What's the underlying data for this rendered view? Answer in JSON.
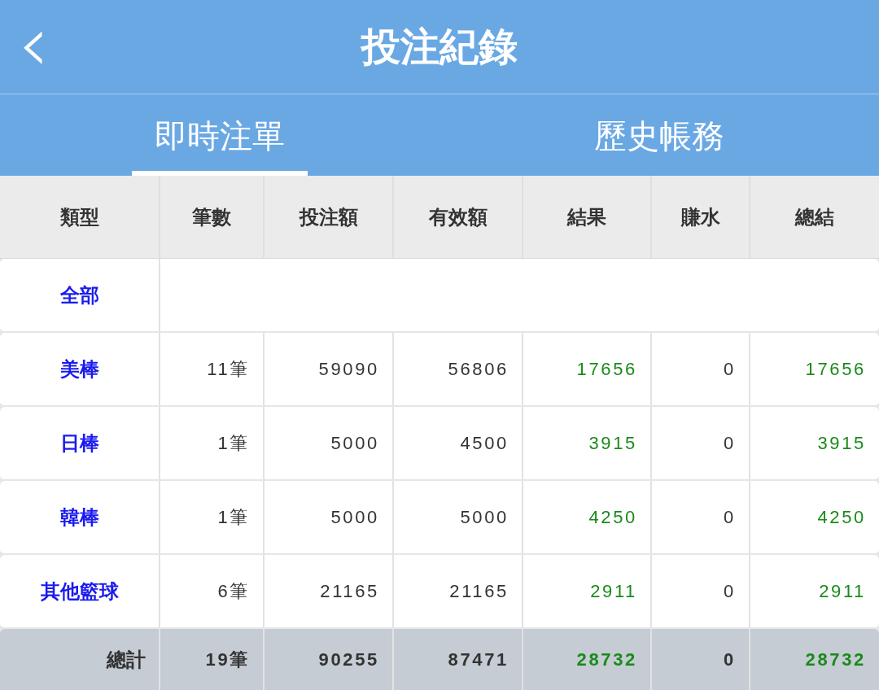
{
  "header": {
    "back_icon": "‹",
    "title": "投注紀錄"
  },
  "tabs": [
    {
      "label": "即時注單",
      "selected": true
    },
    {
      "label": "歷史帳務",
      "selected": false
    }
  ],
  "table": {
    "columns": [
      "類型",
      "筆數",
      "投注額",
      "有效額",
      "結果",
      "賺水",
      "總結"
    ],
    "rows": [
      {
        "type": "全部",
        "cells": []
      },
      {
        "type": "美棒",
        "cells": [
          {
            "text": "11筆",
            "color": "#333333"
          },
          {
            "text": "59090",
            "color": "#333333"
          },
          {
            "text": "56806",
            "color": "#333333"
          },
          {
            "text": "17656",
            "color": "#1a8a1a"
          },
          {
            "text": "0",
            "color": "#333333"
          },
          {
            "text": "17656",
            "color": "#1a8a1a"
          }
        ]
      },
      {
        "type": "日棒",
        "cells": [
          {
            "text": "1筆",
            "color": "#333333"
          },
          {
            "text": "5000",
            "color": "#333333"
          },
          {
            "text": "4500",
            "color": "#333333"
          },
          {
            "text": "3915",
            "color": "#1a8a1a"
          },
          {
            "text": "0",
            "color": "#333333"
          },
          {
            "text": "3915",
            "color": "#1a8a1a"
          }
        ]
      },
      {
        "type": "韓棒",
        "cells": [
          {
            "text": "1筆",
            "color": "#333333"
          },
          {
            "text": "5000",
            "color": "#333333"
          },
          {
            "text": "5000",
            "color": "#333333"
          },
          {
            "text": "4250",
            "color": "#1a8a1a"
          },
          {
            "text": "0",
            "color": "#333333"
          },
          {
            "text": "4250",
            "color": "#1a8a1a"
          }
        ]
      },
      {
        "type": "其他籃球",
        "cells": [
          {
            "text": "6筆",
            "color": "#333333"
          },
          {
            "text": "21165",
            "color": "#333333"
          },
          {
            "text": "21165",
            "color": "#333333"
          },
          {
            "text": "2911",
            "color": "#1a8a1a"
          },
          {
            "text": "0",
            "color": "#333333"
          },
          {
            "text": "2911",
            "color": "#1a8a1a"
          }
        ]
      }
    ],
    "total": {
      "label": "總計",
      "cells": [
        {
          "text": "19筆",
          "color": "#333333"
        },
        {
          "text": "90255",
          "color": "#333333"
        },
        {
          "text": "87471",
          "color": "#333333"
        },
        {
          "text": "28732",
          "color": "#1a8a1a"
        },
        {
          "text": "0",
          "color": "#333333"
        },
        {
          "text": "28732",
          "color": "#1a8a1a"
        }
      ]
    }
  }
}
